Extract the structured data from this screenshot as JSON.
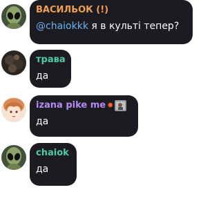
{
  "messages": [
    {
      "sender": "ВАСИЛЬОК (!)",
      "sender_color": "#f0a050",
      "mention": "@chaiokkk",
      "text": " я в культі тепер?"
    },
    {
      "sender": "трава",
      "sender_color": "#4ecca3",
      "text": "да"
    },
    {
      "sender": "izana pike me",
      "sender_color": "#b58cf5",
      "emoji": "💥",
      "text": "да"
    },
    {
      "sender": "chaiok",
      "sender_color": "#4ecca3",
      "text": "да"
    }
  ],
  "icons": [
    "alien-avatar-icon",
    "anime-avatar-icon",
    "boom-icon",
    "sticker-icon"
  ]
}
